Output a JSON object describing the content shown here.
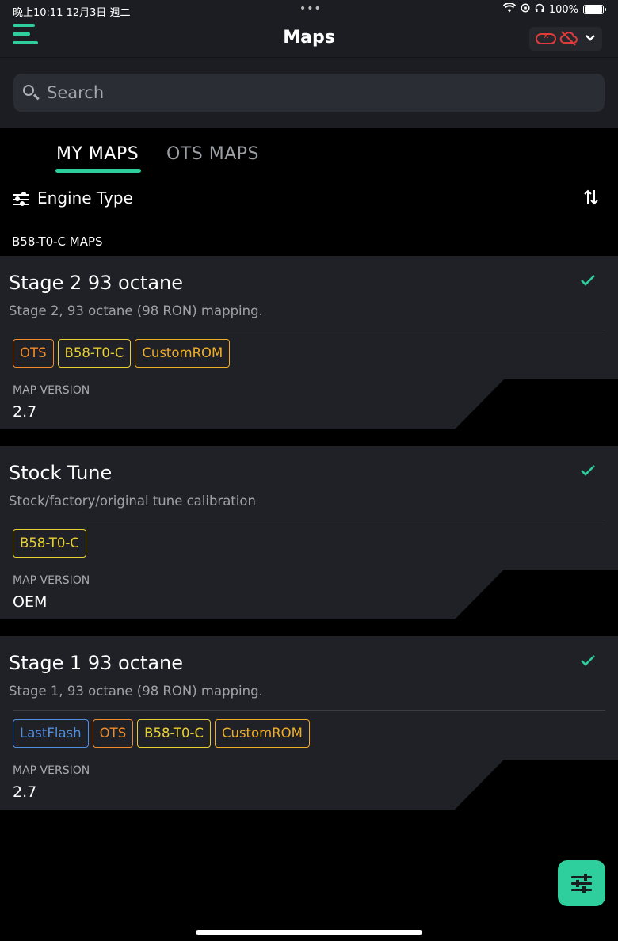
{
  "status": {
    "time": "晚上10:11",
    "date": "12月3日 週二",
    "dots": "•••",
    "battery": "100%"
  },
  "nav": {
    "title": "Maps"
  },
  "search": {
    "placeholder": "Search"
  },
  "tabs": [
    {
      "label": "MY MAPS",
      "active": true
    },
    {
      "label": "OTS MAPS",
      "active": false
    }
  ],
  "filter": {
    "label": "Engine Type"
  },
  "section": {
    "label": "B58-T0-C MAPS"
  },
  "cards": [
    {
      "title": "Stage 2 93 octane",
      "description": "Stage 2, 93 octane (98 RON) mapping.",
      "tags": [
        "OTS",
        "B58-T0-C",
        "CustomROM"
      ],
      "version_label": "MAP VERSION",
      "version": "2.7",
      "selected": true
    },
    {
      "title": "Stock Tune",
      "description": "Stock/factory/original tune calibration",
      "tags": [
        "B58-T0-C"
      ],
      "version_label": "MAP VERSION",
      "version": "OEM",
      "selected": true
    },
    {
      "title": "Stage 1 93 octane",
      "description": "Stage 1, 93 octane (98 RON) mapping.",
      "tags": [
        "LastFlash",
        "OTS",
        "B58-T0-C",
        "CustomROM"
      ],
      "version_label": "MAP VERSION",
      "version": "2.7",
      "selected": true
    }
  ],
  "colors": {
    "accent": "#2ecf9c",
    "error": "#e03b3b",
    "tag_ots": "#f08a2a",
    "tag_engine": "#e8d033",
    "tag_customrom": "#f0ad26",
    "tag_lastflash": "#4f8fe0"
  },
  "icons": {
    "menu": "hamburger-icon",
    "connection": "link-broken-icon",
    "cloud": "cloud-off-icon",
    "search": "search-icon",
    "filter": "sliders-icon",
    "sort": "sort-icon",
    "check": "check-icon",
    "fab": "sliders-icon"
  }
}
